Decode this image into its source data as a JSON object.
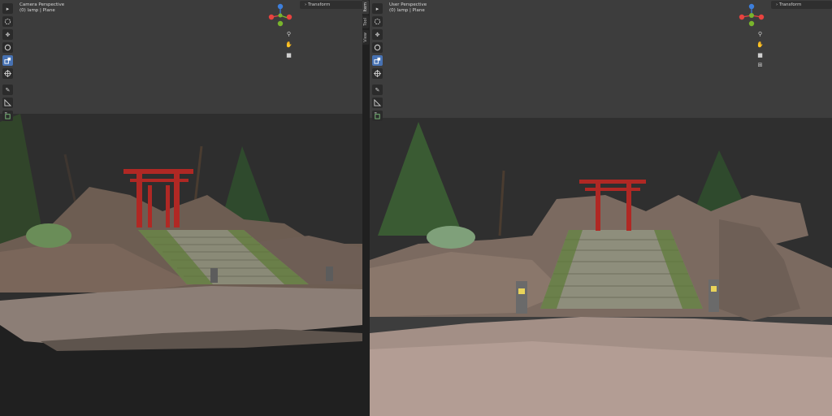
{
  "left_viewport": {
    "view_name": "Camera Perspective",
    "object_info": "(0) lamp | Plane",
    "transform_label": "Transform"
  },
  "right_viewport": {
    "view_name": "User Perspective",
    "object_info": "(0) lamp | Plane",
    "transform_label": "Transform"
  },
  "sidebar_tabs": [
    "Item",
    "Tool",
    "View"
  ],
  "toolbar_icons": [
    "select-box-icon",
    "cursor-icon",
    "move-icon",
    "rotate-icon",
    "scale-icon",
    "transform-icon",
    "annotate-icon",
    "measure-icon",
    "add-cube-icon"
  ],
  "navigation_icons": [
    "zoom-icon",
    "hand-pan-icon",
    "camera-icon",
    "grid-perspective-icon"
  ],
  "colors": {
    "viewport_bg": "#3d3d3d",
    "active_tool": "#4772b3",
    "axis_x": "#e8433f",
    "axis_y": "#79b52c",
    "axis_z": "#3d7fdc"
  }
}
